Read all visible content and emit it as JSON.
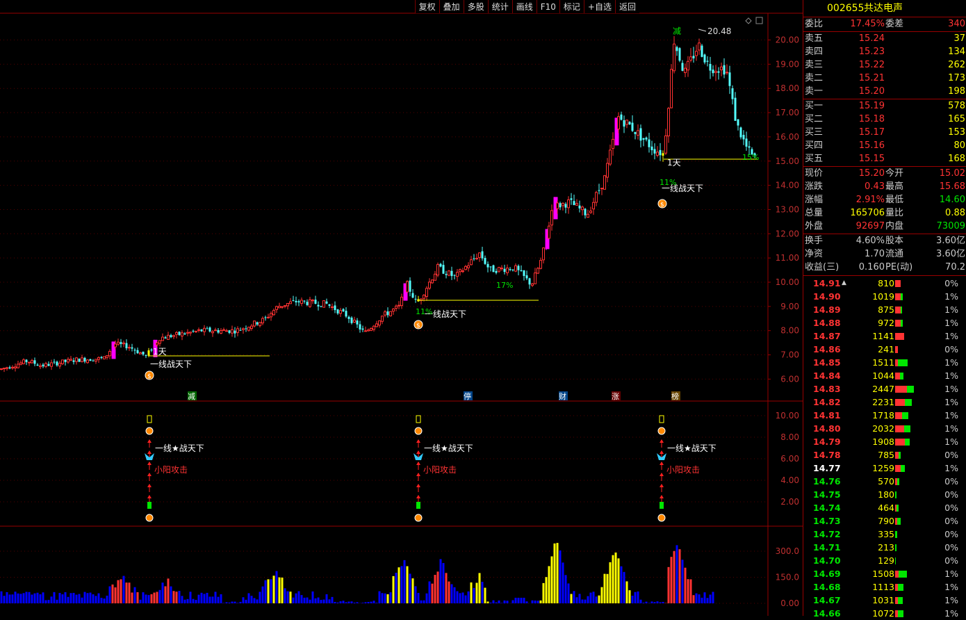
{
  "toolbar": [
    "复权",
    "叠加",
    "多股",
    "统计",
    "画线",
    "F10",
    "标记",
    "+自选",
    "返回"
  ],
  "stock": {
    "code": "002655",
    "name": "共达电声"
  },
  "colors": {
    "up": "#ff3333",
    "down": "#00e600",
    "bull_candle": "#ff3232",
    "bear_candle": "#54ffff",
    "magenta": "#ff00ff",
    "yellow": "#ffff00",
    "blue": "#0000ff",
    "axis_red": "#990000"
  },
  "axes": {
    "main": [
      "20.00",
      "19.00",
      "18.00",
      "17.00",
      "16.00",
      "15.00",
      "14.00",
      "13.00",
      "12.00",
      "11.00",
      "10.00",
      "9.00",
      "8.00",
      "7.00",
      "6.00"
    ],
    "indicator": [
      "10.00",
      "8.00",
      "6.00",
      "4.00",
      "2.00"
    ],
    "volume": [
      "300.0",
      "150.0",
      "0.00"
    ]
  },
  "chart_annotations": {
    "high_label": "20.48",
    "reduce_top": "减",
    "events": [
      "减",
      "停",
      "财",
      "涨",
      "榜"
    ],
    "day_tag": "1天",
    "battle": "一线战天下",
    "pct_small": "11%",
    "pct_17": "17%",
    "pct_15": "15%",
    "ind_battle": "一线★战天下",
    "ind_attack": "小阳攻击"
  },
  "quote": {
    "weibi": {
      "label": "委比",
      "value": "17.45%"
    },
    "weicha": {
      "label": "委差",
      "value": "340"
    },
    "asks": [
      {
        "label": "卖五",
        "price": "15.24",
        "vol": "37"
      },
      {
        "label": "卖四",
        "price": "15.23",
        "vol": "134"
      },
      {
        "label": "卖三",
        "price": "15.22",
        "vol": "262"
      },
      {
        "label": "卖二",
        "price": "15.21",
        "vol": "173"
      },
      {
        "label": "卖一",
        "price": "15.20",
        "vol": "198"
      }
    ],
    "bids": [
      {
        "label": "买一",
        "price": "15.19",
        "vol": "578"
      },
      {
        "label": "买二",
        "price": "15.18",
        "vol": "165"
      },
      {
        "label": "买三",
        "price": "15.17",
        "vol": "153"
      },
      {
        "label": "买四",
        "price": "15.16",
        "vol": "80"
      },
      {
        "label": "买五",
        "price": "15.15",
        "vol": "168"
      }
    ],
    "stats1": [
      {
        "l1": "现价",
        "v1": "15.20",
        "c1": "#ff3333",
        "l2": "今开",
        "v2": "15.02",
        "c2": "#ff3333"
      },
      {
        "l1": "涨跌",
        "v1": "0.43",
        "c1": "#ff3333",
        "l2": "最高",
        "v2": "15.68",
        "c2": "#ff3333"
      },
      {
        "l1": "涨幅",
        "v1": "2.91%",
        "c1": "#ff3333",
        "l2": "最低",
        "v2": "14.60",
        "c2": "#00e600"
      },
      {
        "l1": "总量",
        "v1": "165706",
        "c1": "#ffff00",
        "l2": "量比",
        "v2": "0.88",
        "c2": "#ffff00"
      },
      {
        "l1": "外盘",
        "v1": "92697",
        "c1": "#ff3333",
        "l2": "内盘",
        "v2": "73009",
        "c2": "#00e600"
      }
    ],
    "stats2": [
      {
        "l1": "换手",
        "v1": "4.60%",
        "l2": "股本",
        "v2": "3.60亿"
      },
      {
        "l1": "净资",
        "v1": "1.70",
        "l2": "流通",
        "v2": "3.60亿"
      },
      {
        "l1": "收益(三)",
        "v1": "0.160",
        "l2": "PE(动)",
        "v2": "70.2"
      }
    ]
  },
  "ticks": [
    {
      "price": "14.91",
      "vol": "810",
      "pct": "0%",
      "r": 8,
      "g": 0,
      "marker": "▲"
    },
    {
      "price": "14.90",
      "vol": "1019",
      "pct": "1%",
      "r": 8,
      "g": 3
    },
    {
      "price": "14.89",
      "vol": "875",
      "pct": "1%",
      "r": 8,
      "g": 2
    },
    {
      "price": "14.88",
      "vol": "972",
      "pct": "1%",
      "r": 8,
      "g": 3
    },
    {
      "price": "14.87",
      "vol": "1141",
      "pct": "1%",
      "r": 13,
      "g": 0
    },
    {
      "price": "14.86",
      "vol": "241",
      "pct": "0%",
      "r": 4,
      "g": 0
    },
    {
      "price": "14.85",
      "vol": "1511",
      "pct": "1%",
      "r": 4,
      "g": 14
    },
    {
      "price": "14.84",
      "vol": "1044",
      "pct": "1%",
      "r": 7,
      "g": 5
    },
    {
      "price": "14.83",
      "vol": "2447",
      "pct": "1%",
      "r": 17,
      "g": 10
    },
    {
      "price": "14.82",
      "vol": "2231",
      "pct": "1%",
      "r": 14,
      "g": 10
    },
    {
      "price": "14.81",
      "vol": "1718",
      "pct": "1%",
      "r": 10,
      "g": 9
    },
    {
      "price": "14.80",
      "vol": "2032",
      "pct": "1%",
      "r": 13,
      "g": 9
    },
    {
      "price": "14.79",
      "vol": "1908",
      "pct": "1%",
      "r": 14,
      "g": 7
    },
    {
      "price": "14.78",
      "vol": "785",
      "pct": "0%",
      "r": 5,
      "g": 3
    },
    {
      "price": "14.77",
      "vol": "1259",
      "pct": "1%",
      "r": 8,
      "g": 6
    },
    {
      "price": "14.76",
      "vol": "570",
      "pct": "0%",
      "r": 3,
      "g": 3
    },
    {
      "price": "14.75",
      "vol": "180",
      "pct": "0%",
      "r": 0,
      "g": 2
    },
    {
      "price": "14.74",
      "vol": "464",
      "pct": "0%",
      "r": 2,
      "g": 3
    },
    {
      "price": "14.73",
      "vol": "790",
      "pct": "0%",
      "r": 3,
      "g": 5
    },
    {
      "price": "14.72",
      "vol": "335",
      "pct": "0%",
      "r": 0,
      "g": 3
    },
    {
      "price": "14.71",
      "vol": "213",
      "pct": "0%",
      "r": 0,
      "g": 2
    },
    {
      "price": "14.70",
      "vol": "129",
      "pct": "0%",
      "r": 0,
      "g": 1
    },
    {
      "price": "14.69",
      "vol": "1508",
      "pct": "1%",
      "r": 5,
      "g": 12
    },
    {
      "price": "14.68",
      "vol": "1113",
      "pct": "1%",
      "r": 4,
      "g": 8
    },
    {
      "price": "14.67",
      "vol": "1031",
      "pct": "1%",
      "r": 4,
      "g": 7
    },
    {
      "price": "14.66",
      "vol": "1072",
      "pct": "1%",
      "r": 4,
      "g": 8
    }
  ]
}
